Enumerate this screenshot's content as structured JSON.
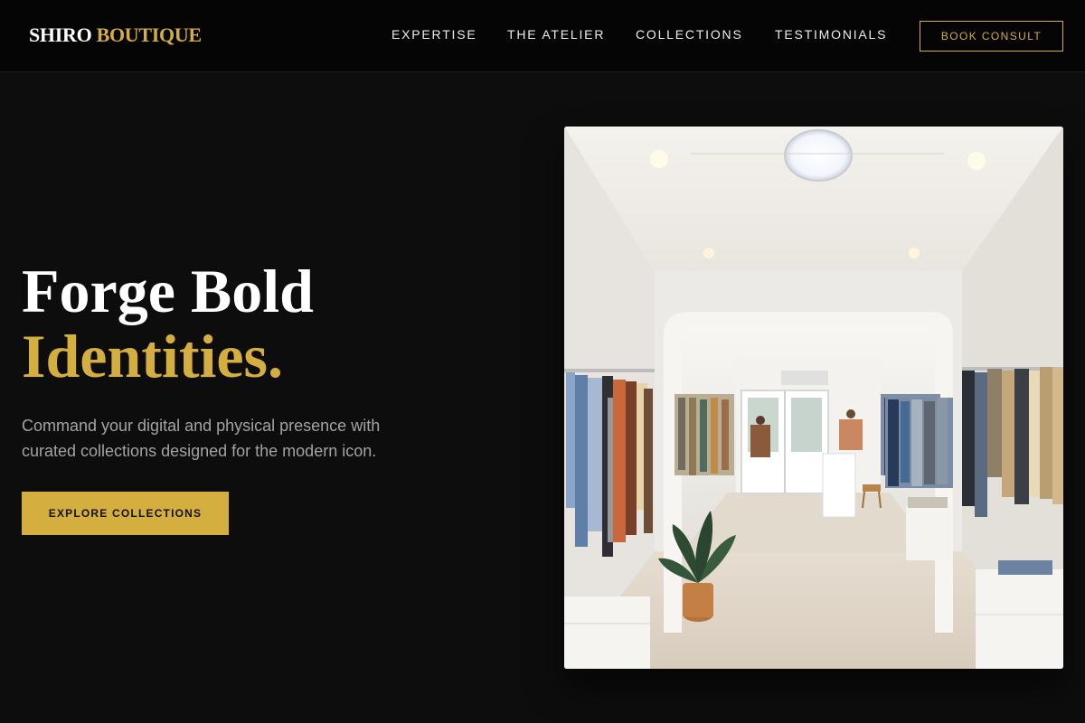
{
  "header": {
    "logo_primary": "SHIRO",
    "logo_accent": "BOUTIQUE",
    "nav": [
      {
        "label": "EXPERTISE"
      },
      {
        "label": "THE ATELIER"
      },
      {
        "label": "COLLECTIONS"
      },
      {
        "label": "TESTIMONIALS"
      }
    ],
    "cta_label": "BOOK CONSULT"
  },
  "hero": {
    "title_line1": "Forge Bold",
    "title_line2": "Identities.",
    "subtitle": "Command your digital and physical presence with curated collections designed for the modern icon.",
    "cta_label": "EXPLORE COLLECTIONS"
  },
  "colors": {
    "accent": "#d4ae3e",
    "background": "#0d0d0d",
    "header_background": "#050505",
    "muted_text": "#a3a3a3"
  }
}
